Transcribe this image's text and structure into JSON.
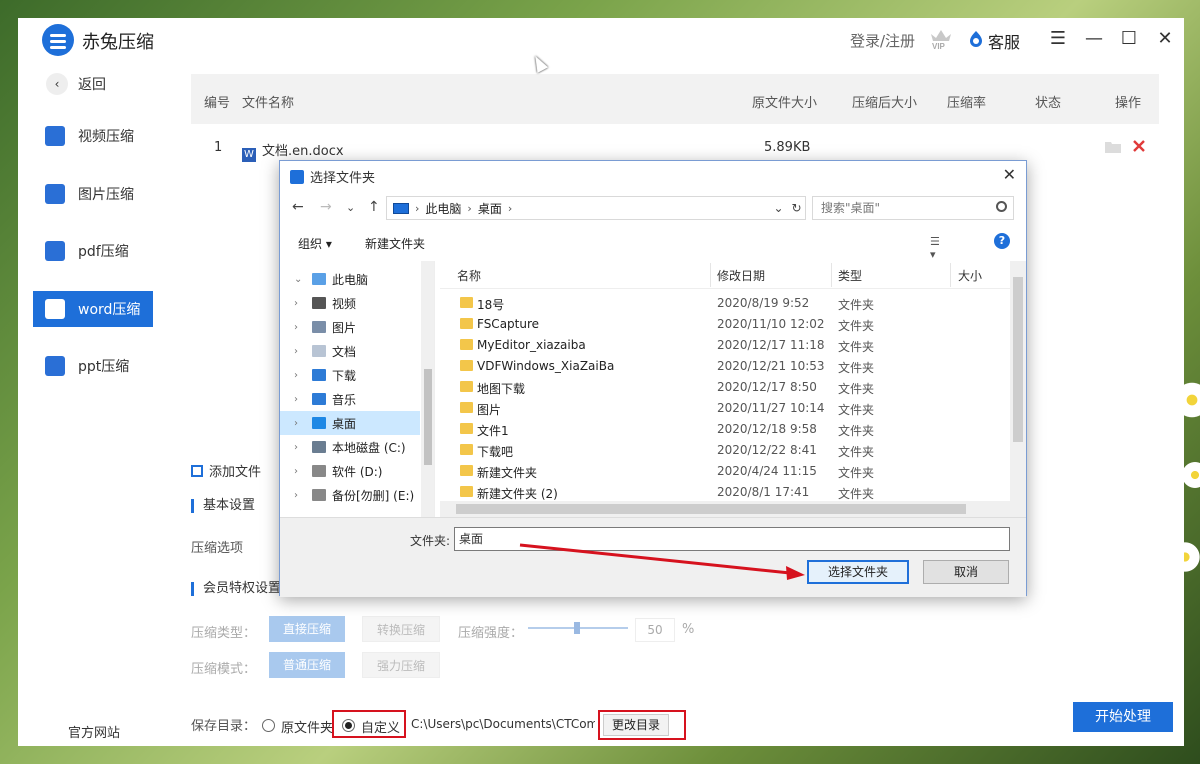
{
  "app": {
    "title": "赤兔压缩",
    "login": "登录/注册",
    "service": "客服",
    "window_controls": {
      "menu": "☰",
      "minimize": "—",
      "maximize": "☐",
      "close": "✕"
    }
  },
  "sidebar": {
    "back": "返回",
    "items": [
      {
        "label": "视频压缩",
        "icon": "video-icon"
      },
      {
        "label": "图片压缩",
        "icon": "image-icon"
      },
      {
        "label": "pdf压缩",
        "icon": "pdf-icon"
      },
      {
        "label": "word压缩",
        "icon": "word-icon",
        "active": true
      },
      {
        "label": "ppt压缩",
        "icon": "ppt-icon"
      }
    ],
    "official_site": "官方网站"
  },
  "table": {
    "headers": [
      "编号",
      "文件名称",
      "原文件大小",
      "压缩后大小",
      "压缩率",
      "状态",
      "操作"
    ],
    "rows": [
      {
        "index": "1",
        "name": "文档.en.docx",
        "size": "5.89KB"
      }
    ]
  },
  "settings": {
    "add_file": "添加文件",
    "basic_title": "基本设置",
    "compress_option_label": "压缩选项",
    "vip_title": "会员特权设置",
    "type_label": "压缩类型：",
    "type_options": [
      "直接压缩",
      "转换压缩"
    ],
    "strength_label": "压缩强度：",
    "strength_value": "50",
    "strength_unit": "%",
    "strength_level": 0.5,
    "mode_label": "压缩模式：",
    "mode_options": [
      "普通压缩",
      "强力压缩"
    ],
    "save_dir_label": "保存目录：",
    "save_options": [
      "原文件夹",
      "自定义"
    ],
    "save_path": "C:\\Users\\pc\\Documents\\CTCom",
    "change_dir": "更改目录",
    "start": "开始处理"
  },
  "dialog": {
    "title": "选择文件夹",
    "close": "✕",
    "nav": {
      "back": "←",
      "forward": "→",
      "recent": "⌄",
      "up": "↑"
    },
    "breadcrumb": [
      "此电脑",
      "桌面"
    ],
    "search_placeholder": "搜索\"桌面\"",
    "toolbar": {
      "organize": "组织 ▾",
      "new_folder": "新建文件夹",
      "help": "?"
    },
    "tree": [
      {
        "label": "此电脑",
        "caret": "⌄"
      },
      {
        "label": "视频",
        "caret": "›"
      },
      {
        "label": "图片",
        "caret": "›"
      },
      {
        "label": "文档",
        "caret": "›"
      },
      {
        "label": "下载",
        "caret": "›"
      },
      {
        "label": "音乐",
        "caret": "›"
      },
      {
        "label": "桌面",
        "caret": "›",
        "selected": true
      },
      {
        "label": "本地磁盘 (C:)",
        "caret": "›"
      },
      {
        "label": "软件 (D:)",
        "caret": "›"
      },
      {
        "label": "备份[勿删] (E:)",
        "caret": "›"
      }
    ],
    "columns": [
      "名称",
      "修改日期",
      "类型",
      "大小"
    ],
    "files": [
      {
        "name": "18号",
        "date": "2020/8/19 9:52",
        "type": "文件夹"
      },
      {
        "name": "FSCapture",
        "date": "2020/11/10 12:02",
        "type": "文件夹"
      },
      {
        "name": "MyEditor_xiazaiba",
        "date": "2020/12/17 11:18",
        "type": "文件夹"
      },
      {
        "name": "VDFWindows_XiaZaiBa",
        "date": "2020/12/21 10:53",
        "type": "文件夹"
      },
      {
        "name": "地图下载",
        "date": "2020/12/17 8:50",
        "type": "文件夹"
      },
      {
        "name": "图片",
        "date": "2020/11/27 10:14",
        "type": "文件夹"
      },
      {
        "name": "文件1",
        "date": "2020/12/18 9:58",
        "type": "文件夹"
      },
      {
        "name": "下载吧",
        "date": "2020/12/22 8:41",
        "type": "文件夹"
      },
      {
        "name": "新建文件夹",
        "date": "2020/4/24 11:15",
        "type": "文件夹"
      },
      {
        "name": "新建文件夹 (2)",
        "date": "2020/8/1 17:41",
        "type": "文件夹"
      }
    ],
    "folder_label": "文件夹:",
    "folder_value": "桌面",
    "select_button": "选择文件夹",
    "cancel_button": "取消"
  },
  "colors": {
    "accent": "#1e6fd9",
    "highlight": "#d6121e"
  }
}
